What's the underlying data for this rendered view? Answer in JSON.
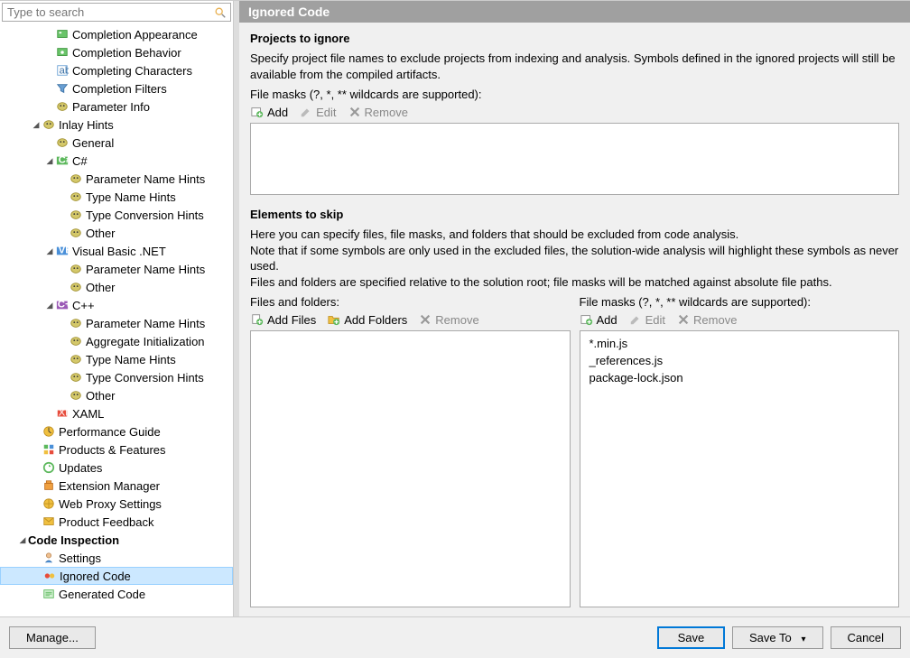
{
  "search": {
    "placeholder": "Type to search"
  },
  "tree": [
    {
      "level": 3,
      "arrow": "",
      "icon": "appearance-icon",
      "color": "ico-blue",
      "label": "Completion Appearance"
    },
    {
      "level": 3,
      "arrow": "",
      "icon": "behavior-icon",
      "color": "ico-blue",
      "label": "Completion Behavior"
    },
    {
      "level": 3,
      "arrow": "",
      "icon": "characters-icon",
      "color": "ico-blue",
      "label": "Completing Characters"
    },
    {
      "level": 3,
      "arrow": "",
      "icon": "filter-icon",
      "color": "ico-blue",
      "label": "Completion Filters"
    },
    {
      "level": 3,
      "arrow": "",
      "icon": "param-icon",
      "color": "ico-param",
      "label": "Parameter Info"
    },
    {
      "level": 2,
      "arrow": "down",
      "icon": "hint-icon",
      "color": "ico-param",
      "label": "Inlay Hints"
    },
    {
      "level": 3,
      "arrow": "",
      "icon": "hint-icon",
      "color": "ico-param",
      "label": "General"
    },
    {
      "level": 3,
      "arrow": "down",
      "icon": "csharp-icon",
      "color": "ico-green",
      "label": "C#"
    },
    {
      "level": 4,
      "arrow": "",
      "icon": "hint-icon",
      "color": "ico-param",
      "label": "Parameter Name Hints"
    },
    {
      "level": 4,
      "arrow": "",
      "icon": "hint-icon",
      "color": "ico-param",
      "label": "Type Name Hints"
    },
    {
      "level": 4,
      "arrow": "",
      "icon": "hint-icon",
      "color": "ico-param",
      "label": "Type Conversion Hints"
    },
    {
      "level": 4,
      "arrow": "",
      "icon": "hint-icon",
      "color": "ico-param",
      "label": "Other"
    },
    {
      "level": 3,
      "arrow": "down",
      "icon": "vb-icon",
      "color": "ico-blue",
      "label": "Visual Basic .NET"
    },
    {
      "level": 4,
      "arrow": "",
      "icon": "hint-icon",
      "color": "ico-param",
      "label": "Parameter Name Hints"
    },
    {
      "level": 4,
      "arrow": "",
      "icon": "hint-icon",
      "color": "ico-param",
      "label": "Other"
    },
    {
      "level": 3,
      "arrow": "down",
      "icon": "cpp-icon",
      "color": "ico-purple",
      "label": "C++"
    },
    {
      "level": 4,
      "arrow": "",
      "icon": "hint-icon",
      "color": "ico-param",
      "label": "Parameter Name Hints"
    },
    {
      "level": 4,
      "arrow": "",
      "icon": "hint-icon",
      "color": "ico-param",
      "label": "Aggregate Initialization"
    },
    {
      "level": 4,
      "arrow": "",
      "icon": "hint-icon",
      "color": "ico-param",
      "label": "Type Name Hints"
    },
    {
      "level": 4,
      "arrow": "",
      "icon": "hint-icon",
      "color": "ico-param",
      "label": "Type Conversion Hints"
    },
    {
      "level": 4,
      "arrow": "",
      "icon": "hint-icon",
      "color": "ico-param",
      "label": "Other"
    },
    {
      "level": 3,
      "arrow": "",
      "icon": "xaml-icon",
      "color": "ico-orange",
      "label": "XAML"
    },
    {
      "level": 2,
      "arrow": "",
      "icon": "perf-icon",
      "color": "ico-orange",
      "label": "Performance Guide"
    },
    {
      "level": 2,
      "arrow": "",
      "icon": "products-icon",
      "color": "ico-green",
      "label": "Products & Features"
    },
    {
      "level": 2,
      "arrow": "",
      "icon": "updates-icon",
      "color": "ico-green",
      "label": "Updates"
    },
    {
      "level": 2,
      "arrow": "",
      "icon": "ext-icon",
      "color": "ico-orange",
      "label": "Extension Manager"
    },
    {
      "level": 2,
      "arrow": "",
      "icon": "proxy-icon",
      "color": "ico-orange",
      "label": "Web Proxy Settings"
    },
    {
      "level": 2,
      "arrow": "",
      "icon": "feedback-icon",
      "color": "ico-orange",
      "label": "Product Feedback"
    },
    {
      "level": 1,
      "arrow": "down",
      "icon": "",
      "color": "",
      "label": "Code Inspection",
      "bold": true
    },
    {
      "level": 2,
      "arrow": "",
      "icon": "settings-icon",
      "color": "ico-blue",
      "label": "Settings"
    },
    {
      "level": 2,
      "arrow": "",
      "icon": "ignored-icon",
      "color": "ico-orange",
      "label": "Ignored Code",
      "selected": true
    },
    {
      "level": 2,
      "arrow": "",
      "icon": "generated-icon",
      "color": "ico-green",
      "label": "Generated Code"
    }
  ],
  "header": {
    "title": "Ignored Code"
  },
  "projects": {
    "title": "Projects to ignore",
    "desc": "Specify project file names to exclude projects from indexing and analysis. Symbols defined in the ignored projects will still be available from the compiled artifacts.",
    "masks_label": "File masks (?, *, ** wildcards are supported):",
    "add": "Add",
    "edit": "Edit",
    "remove": "Remove"
  },
  "elements": {
    "title": "Elements to skip",
    "desc1": "Here you can specify files, file masks, and folders that should be excluded from code analysis.",
    "desc2": "Note that if some symbols are only used in the excluded files, the solution-wide analysis will highlight these symbols as never used.",
    "desc3": "Files and folders are specified relative to the solution root; file masks will be matched against absolute file paths.",
    "files_label": "Files and folders:",
    "masks_label": "File masks (?, *, ** wildcards are supported):",
    "add_files": "Add Files",
    "add_folders": "Add Folders",
    "remove": "Remove",
    "add": "Add",
    "edit": "Edit",
    "mask_items": [
      "*.min.js",
      "_references.js",
      "package-lock.json"
    ]
  },
  "buttons": {
    "manage": "Manage...",
    "save": "Save",
    "save_to": "Save To",
    "cancel": "Cancel"
  }
}
